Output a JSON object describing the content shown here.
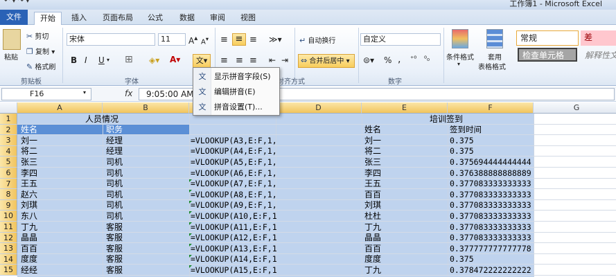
{
  "titlebar": {
    "quick_access": "↶ ▾  ↷ ▾",
    "title": "工作簿1 - Microsoft Excel"
  },
  "tabs": [
    "文件",
    "开始",
    "插入",
    "页面布局",
    "公式",
    "数据",
    "审阅",
    "视图"
  ],
  "ribbon": {
    "paste": "粘贴",
    "cut": "剪切",
    "copy": "复制 ▾",
    "format_painter": "格式刷",
    "clipboard_label": "剪贴板",
    "font_name": "宋体",
    "font_size": "11",
    "font_label": "字体",
    "bold": "B",
    "italic": "I",
    "underline": "U",
    "wrap_text": "自动换行",
    "merge_center": "合并后居中",
    "align_label": "对齐方式",
    "number_format": "自定义",
    "percent": "%",
    "comma": ",",
    "number_label": "数字",
    "cond_format": "条件格式",
    "table_format_1": "套用",
    "table_format_2": "表格格式",
    "style_normal": "常规",
    "style_bad": "差",
    "style_check": "检查单元格",
    "style_explain": "解释性文"
  },
  "formula_bar": {
    "name_box": "F16",
    "fx": "fx",
    "formula": "9:05:00 AM"
  },
  "columns": [
    "A",
    "B",
    "C",
    "D",
    "E",
    "F",
    "G"
  ],
  "rows": [
    {
      "n": "1",
      "a": "人员情况",
      "c": "",
      "e": "培训签到",
      "f": ""
    },
    {
      "n": "2",
      "a": "姓名",
      "b": "职务",
      "c": "",
      "e": "姓名",
      "f": "签到时间"
    },
    {
      "n": "3",
      "a": "刘一",
      "b": "经理",
      "c": "=VLOOKUP(A3,E:F,1,",
      "e": "刘一",
      "f": "0.375"
    },
    {
      "n": "4",
      "a": "将二",
      "b": "经理",
      "c": "=VLOOKUP(A4,E:F,1,",
      "e": "将二",
      "f": "0.375"
    },
    {
      "n": "5",
      "a": "张三",
      "b": "司机",
      "c": "=VLOOKUP(A5,E:F,1,",
      "e": "张三",
      "f": "0.375694444444444"
    },
    {
      "n": "6",
      "a": "李四",
      "b": "司机",
      "c": "=VLOOKUP(A6,E:F,1,",
      "e": "李四",
      "f": "0.376388888888889"
    },
    {
      "n": "7",
      "a": "王五",
      "b": "司机",
      "c": "=VLOOKUP(A7,E:F,1,",
      "e": "王五",
      "f": "0.377083333333333"
    },
    {
      "n": "8",
      "a": "赵六",
      "b": "司机",
      "c": "=VLOOKUP(A8,E:F,1,",
      "e": "百百",
      "f": "0.377083333333333"
    },
    {
      "n": "9",
      "a": "刘琪",
      "b": "司机",
      "c": "=VLOOKUP(A9,E:F,1,",
      "e": "刘琪",
      "f": "0.377083333333333"
    },
    {
      "n": "10",
      "a": "东八",
      "b": "司机",
      "c": "=VLOOKUP(A10,E:F,1",
      "e": "杜杜",
      "f": "0.377083333333333"
    },
    {
      "n": "11",
      "a": "丁九",
      "b": "客服",
      "c": "=VLOOKUP(A11,E:F,1",
      "e": "丁九",
      "f": "0.377083333333333"
    },
    {
      "n": "12",
      "a": "晶晶",
      "b": "客服",
      "c": "=VLOOKUP(A12,E:F,1",
      "e": "晶晶",
      "f": "0.377083333333333"
    },
    {
      "n": "13",
      "a": "百百",
      "b": "客服",
      "c": "=VLOOKUP(A13,E:F,1",
      "e": "百百",
      "f": "0.377777777777778"
    },
    {
      "n": "14",
      "a": "度度",
      "b": "客服",
      "c": "=VLOOKUP(A14,E:F,1",
      "e": "度度",
      "f": "0.375"
    },
    {
      "n": "15",
      "a": "经经",
      "b": "客服",
      "c": "=VLOOKUP(A15,E:F,1",
      "e": "丁九",
      "f": "0.378472222222222"
    }
  ],
  "phonetic_menu": {
    "items": [
      "显示拼音字段(S)",
      "编辑拼音(E)",
      "拼音设置(T)..."
    ],
    "button_glyph": "文"
  },
  "colors": {
    "file_tab": "#2a62b6",
    "selection": "#bfd3ee",
    "highlight": "#f8cd5c"
  }
}
